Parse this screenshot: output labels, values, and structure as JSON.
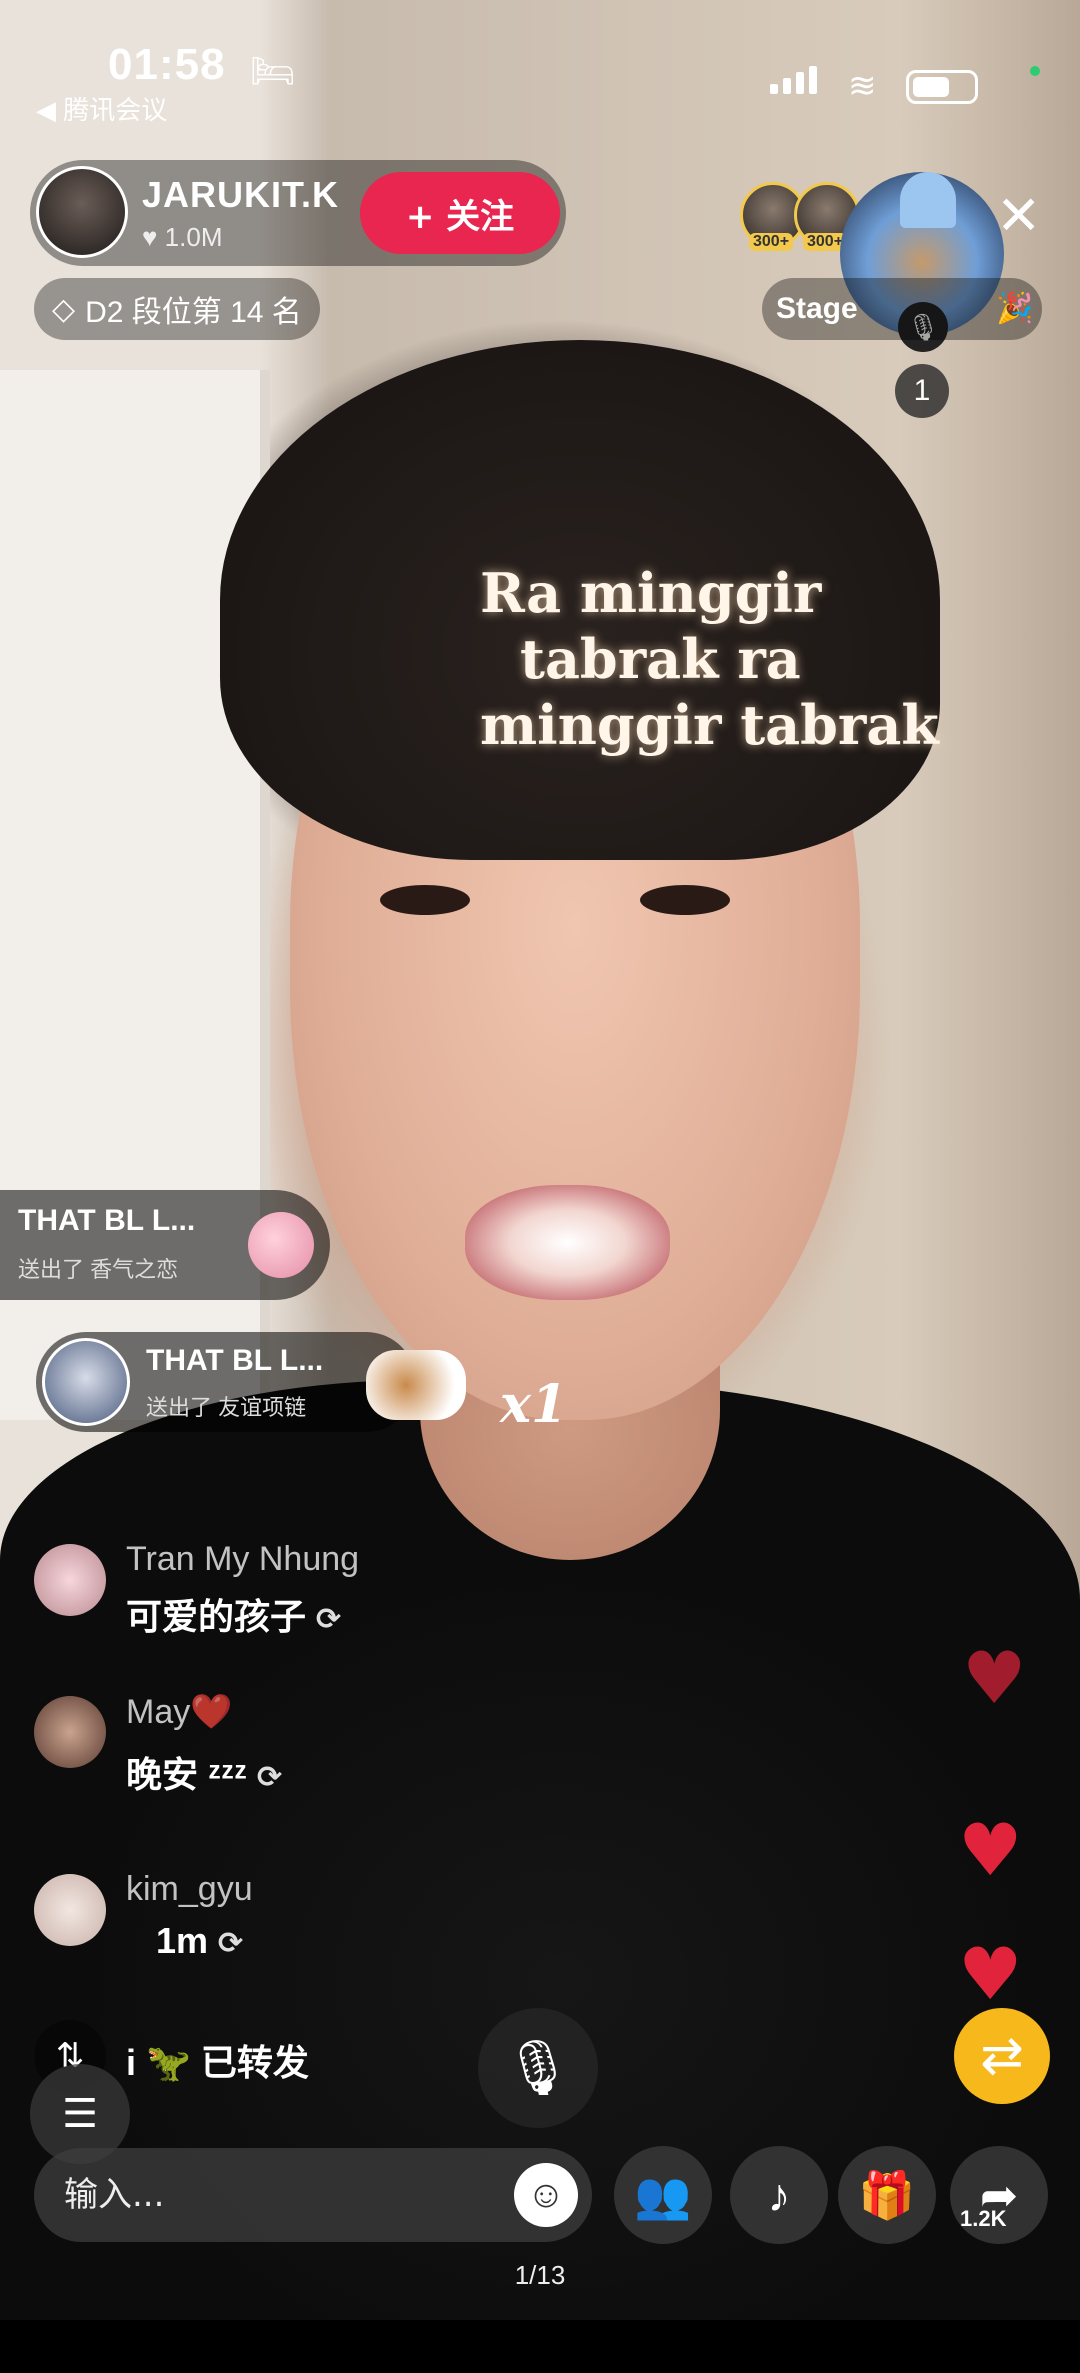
{
  "status_bar": {
    "time": "01:58",
    "back_app": "◀ 腾讯会议"
  },
  "host": {
    "name": "JARUKIT.K",
    "likes": "1.0M",
    "follow_label": "+ 关注"
  },
  "top_viewers": [
    {
      "badge": "300+"
    },
    {
      "badge": "300+"
    }
  ],
  "guest": {
    "count": "1"
  },
  "rank": {
    "label": "D2 段位第 14 名"
  },
  "stage": {
    "label": "Stage"
  },
  "overlay_text": {
    "line1": "Ra minggir",
    "line2": "tabrak ra",
    "line3": "minggir tabrak"
  },
  "gift_notices": [
    {
      "name": "THAT BL L...",
      "text": "送出了 香气之恋"
    },
    {
      "name": "THAT BL L...",
      "text": "送出了 友谊项链",
      "combo": "x1"
    }
  ],
  "comments": [
    {
      "name": "Tran My Nhung",
      "text": "可爱的孩子"
    },
    {
      "name": "May❤️",
      "text": "晚安 ᶻᶻᶻ"
    },
    {
      "name": "kim_gyu",
      "text": "1m"
    }
  ],
  "share_event": {
    "text": "i 🦖 已转发"
  },
  "input": {
    "placeholder": "输入..."
  },
  "actions": {
    "share_count": "1.2K"
  },
  "page_indicator": "1/13",
  "colors": {
    "follow_button": "#e8264f",
    "heart": "#e1243c",
    "repost_button": "#f6b81a"
  }
}
